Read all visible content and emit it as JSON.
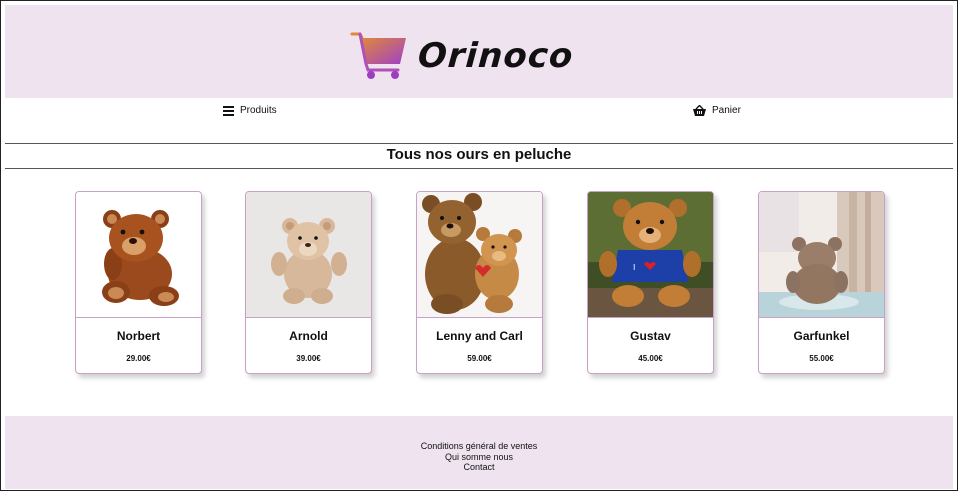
{
  "brand": {
    "name": "Orinoco"
  },
  "nav": {
    "products_label": "Produits",
    "cart_label": "Panier"
  },
  "page": {
    "title": "Tous nos ours en peluche"
  },
  "products": [
    {
      "name": "Norbert",
      "price": "29.00€",
      "image": "brown-teddy-bear"
    },
    {
      "name": "Arnold",
      "price": "39.00€",
      "image": "beige-teddy-bear"
    },
    {
      "name": "Lenny and Carl",
      "price": "59.00€",
      "image": "two-teddy-bears"
    },
    {
      "name": "Gustav",
      "price": "45.00€",
      "image": "teddy-bear-blue-shirt"
    },
    {
      "name": "Garfunkel",
      "price": "55.00€",
      "image": "teddy-bear-back-view"
    }
  ],
  "footer": {
    "links": [
      "Conditions général de ventes",
      "Qui somme nous",
      "Contact"
    ]
  },
  "colors": {
    "header_bg": "#efe3ef",
    "card_border": "#c9a0c9",
    "logo_gradient_start": "#e0873a",
    "logo_gradient_end": "#a040c8"
  }
}
